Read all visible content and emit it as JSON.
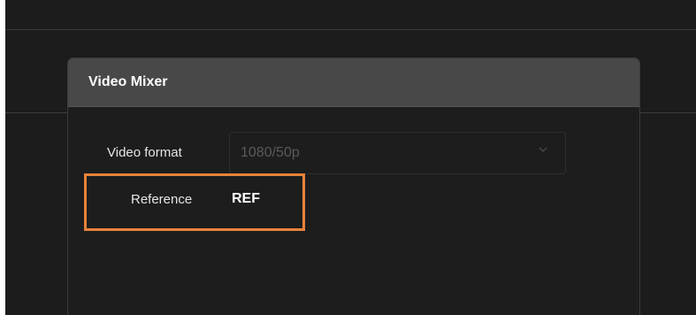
{
  "dialog": {
    "title": "Video Mixer"
  },
  "fields": {
    "video_format": {
      "label": "Video format",
      "value": "1080/50p"
    },
    "reference": {
      "label": "Reference",
      "value": "REF"
    }
  },
  "colors": {
    "highlight": "#e8823a",
    "header_bg": "#484848",
    "background": "#1c1c1c"
  }
}
